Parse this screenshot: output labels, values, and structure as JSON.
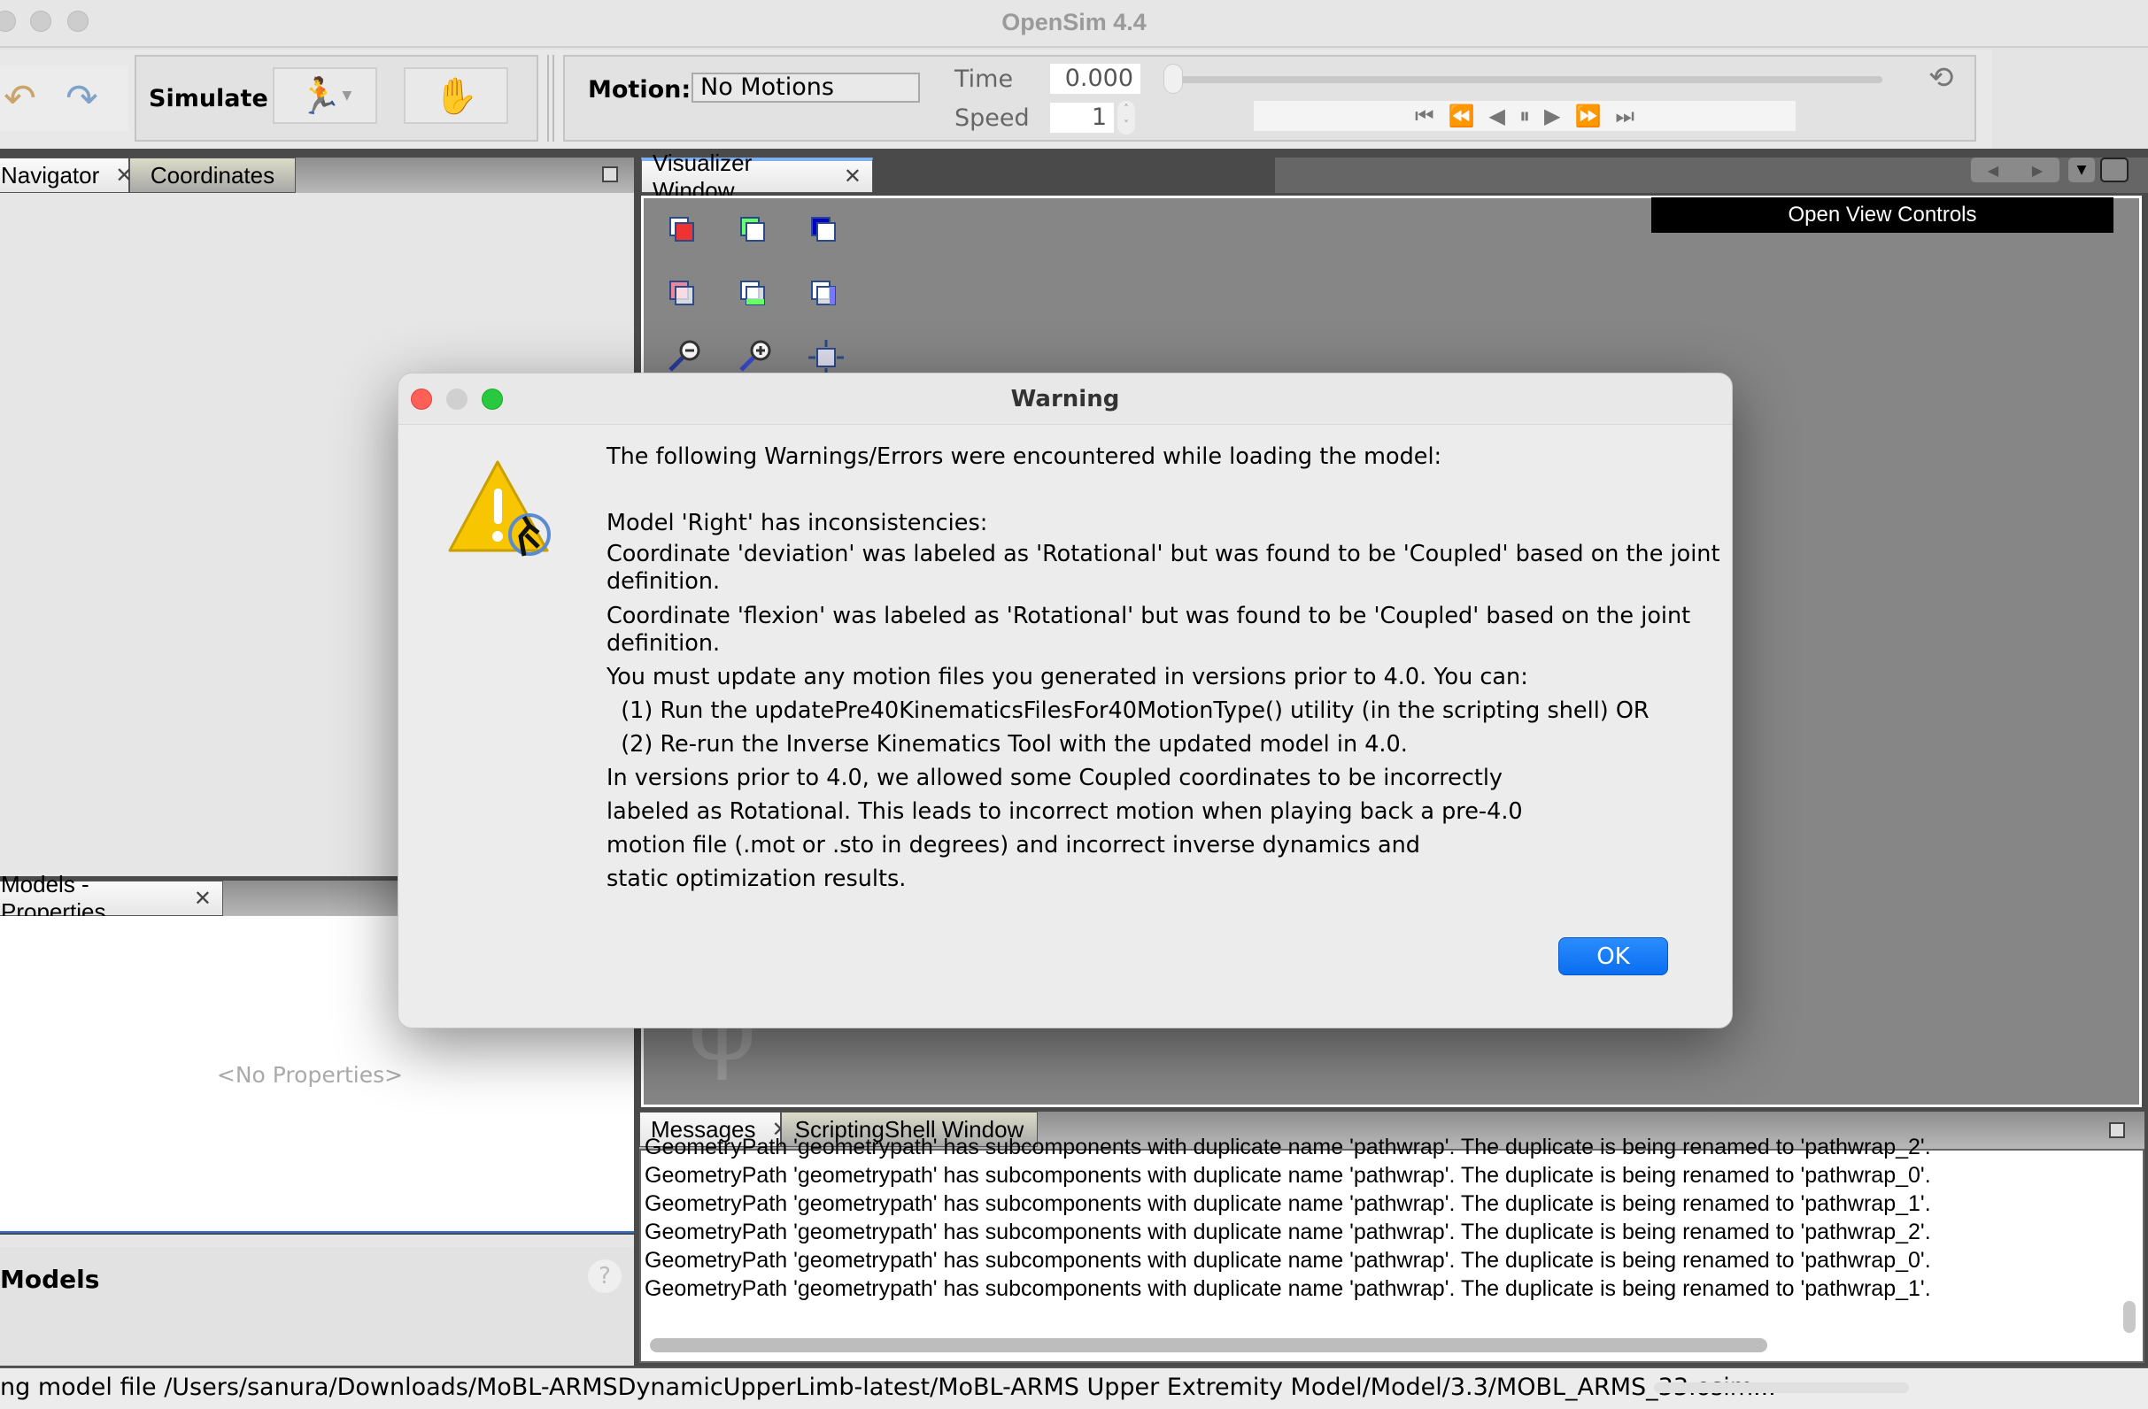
{
  "window": {
    "title": "OpenSim 4.4"
  },
  "toolbar": {
    "undo_icon": "undo-icon",
    "redo_icon": "redo-icon",
    "simulate_label": "Simulate",
    "motion_label": "Motion:",
    "motion_value": "No Motions",
    "time_label": "Time",
    "time_value": "0.000",
    "speed_label": "Speed",
    "speed_value": "1",
    "time_slider_fraction": 0
  },
  "left": {
    "tabs": [
      {
        "label": "Navigator"
      },
      {
        "label": "Coordinates"
      }
    ],
    "properties_tab": "Models - Properties",
    "no_properties": "<No Properties>",
    "models_title": "Models",
    "help": "?"
  },
  "visualizer": {
    "tab": "Visualizer Window",
    "open_view_controls": "Open View Controls"
  },
  "bottom": {
    "tabs": [
      {
        "label": "Messages"
      },
      {
        "label": "ScriptingShell Window"
      }
    ],
    "messages": [
      "GeometryPath 'geometrypath' has subcomponents with duplicate name 'pathwrap'. The duplicate is being renamed to 'pathwrap_2'.",
      "GeometryPath 'geometrypath' has subcomponents with duplicate name 'pathwrap'. The duplicate is being renamed to 'pathwrap_0'.",
      "GeometryPath 'geometrypath' has subcomponents with duplicate name 'pathwrap'. The duplicate is being renamed to 'pathwrap_1'.",
      "GeometryPath 'geometrypath' has subcomponents with duplicate name 'pathwrap'. The duplicate is being renamed to 'pathwrap_2'.",
      "GeometryPath 'geometrypath' has subcomponents with duplicate name 'pathwrap'. The duplicate is being renamed to 'pathwrap_0'.",
      "GeometryPath 'geometrypath' has subcomponents with duplicate name 'pathwrap'. The duplicate is being renamed to 'pathwrap_1'."
    ]
  },
  "status": {
    "text": "ng model file /Users/sanura/Downloads/MoBL-ARMSDynamicUpperLimb-latest/MoBL-ARMS Upper Extremity Model/Model/3.3/MOBL_ARMS_33.osim..."
  },
  "dialog": {
    "title": "Warning",
    "lines": [
      "The following Warnings/Errors were encountered while loading the model:",
      "",
      "Model 'Right' has inconsistencies:",
      "Coordinate 'deviation' was labeled as 'Rotational' but was found to be 'Coupled' based on the joint",
      "definition.",
      "Coordinate 'flexion' was labeled as 'Rotational' but was found to be 'Coupled' based on the joint",
      "definition.",
      "You must update any motion files you generated in versions prior to 4.0. You can:",
      "  (1) Run the updatePre40KinematicsFilesFor40MotionType() utility (in the scripting shell) OR",
      "  (2) Re-run the Inverse Kinematics Tool with the updated model in 4.0.",
      "In versions prior to 4.0, we allowed some Coupled coordinates to be incorrectly",
      "labeled as Rotational. This leads to incorrect motion when playing back a pre-4.0",
      "motion file (.mot or .sto in degrees) and incorrect inverse dynamics and",
      "static optimization results."
    ],
    "ok": "OK"
  }
}
